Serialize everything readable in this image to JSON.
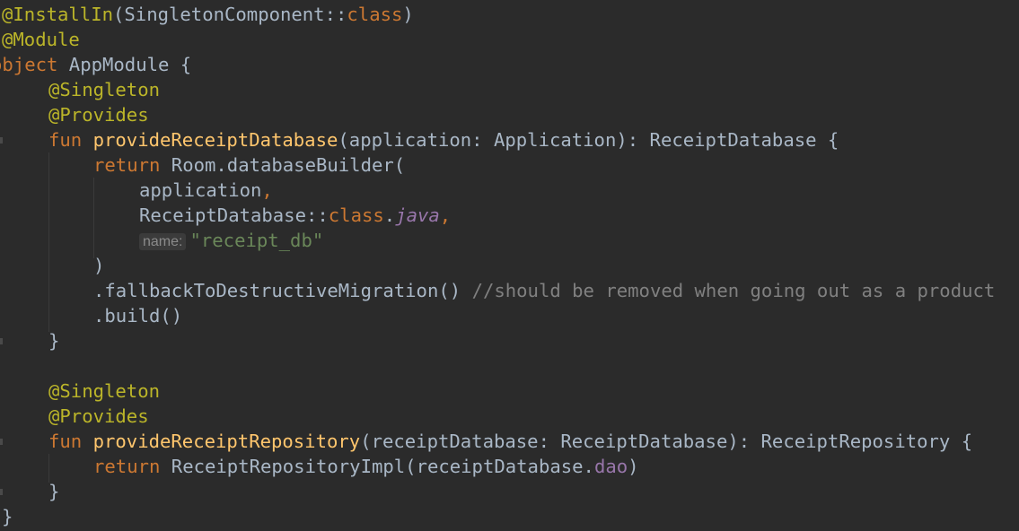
{
  "code": {
    "line1": {
      "annotation": "@InstallIn",
      "paren_open": "(",
      "component": "SingletonComponent::",
      "class_kw": "class",
      "paren_close": ")"
    },
    "line2": {
      "annotation": "@Module"
    },
    "line3": {
      "keyword": "object",
      "name": " AppModule {"
    },
    "line4": {
      "annotation": "@Singleton"
    },
    "line5": {
      "annotation": "@Provides"
    },
    "line6": {
      "keyword": "fun ",
      "fn_name": "provideReceiptDatabase",
      "signature": "(application: Application): ReceiptDatabase {"
    },
    "line7": {
      "keyword": "return ",
      "call": "Room.databaseBuilder("
    },
    "line8": {
      "arg": "application",
      "comma": ","
    },
    "line9": {
      "ref": "ReceiptDatabase::",
      "class_kw": "class",
      "dot": ".",
      "java": "java",
      "comma": ","
    },
    "line10": {
      "hint": "name:",
      "string": "\"receipt_db\""
    },
    "line11": {
      "text": ")"
    },
    "line12": {
      "call": ".fallbackToDestructiveMigration() ",
      "comment": "//should be removed when going out as a product"
    },
    "line13": {
      "call": ".build()"
    },
    "line14": {
      "text": "}"
    },
    "line16": {
      "annotation": "@Singleton"
    },
    "line17": {
      "annotation": "@Provides"
    },
    "line18": {
      "keyword": "fun ",
      "fn_name": "provideReceiptRepository",
      "signature": "(receiptDatabase: ReceiptDatabase): ReceiptRepository {"
    },
    "line19": {
      "keyword": "return ",
      "call": "ReceiptRepositoryImpl(receiptDatabase.",
      "field": "dao",
      "paren_close": ")"
    },
    "line20": {
      "text": "}"
    },
    "line21": {
      "text": "}"
    }
  },
  "colors": {
    "background": "#2b2b2b",
    "annotation": "#bbb529",
    "keyword": "#cc7832",
    "function": "#ffc66d",
    "identifier": "#a9b7c6",
    "string": "#6a8759",
    "comment": "#808080",
    "field": "#9876aa"
  }
}
